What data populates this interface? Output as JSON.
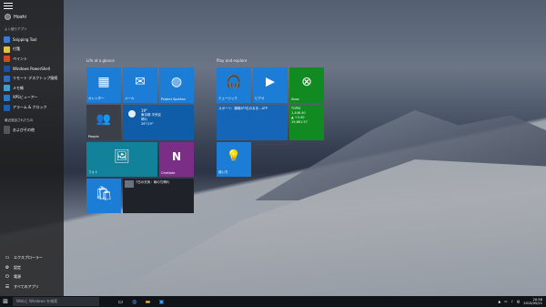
{
  "user": {
    "name": "Hoshi"
  },
  "start": {
    "most_used_label": "よく使うアプリ",
    "apps": [
      {
        "label": "Snipping Tool",
        "color": "#3a7bd5"
      },
      {
        "label": "付箋",
        "color": "#e1c542"
      },
      {
        "label": "ペイント",
        "color": "#d04a2a"
      },
      {
        "label": "Windows PowerShell",
        "color": "#1d4f9a"
      },
      {
        "label": "リモート デスクトップ接続",
        "color": "#2b6cc4"
      },
      {
        "label": "メモ帳",
        "color": "#3aa0d8"
      },
      {
        "label": "XPSビューアー",
        "color": "#2a7ac8"
      },
      {
        "label": "アラーム & クロック",
        "color": "#1b5fb0"
      }
    ],
    "recent_label": "最近追加されたもの",
    "recent_app": "およびその他",
    "bottom": [
      {
        "label": "エクスプローラー",
        "glyph": "▭"
      },
      {
        "label": "設定",
        "glyph": "⚙"
      },
      {
        "label": "電源",
        "glyph": "⏻"
      },
      {
        "label": "すべてのアプリ",
        "glyph": "☰"
      }
    ]
  },
  "groups": {
    "left": "Life at a glance",
    "right": "Play and explore"
  },
  "tiles": {
    "calendar": "カレンダー",
    "mail": "メール",
    "project_spartan": "Project Spartan",
    "people": "People",
    "weather": {
      "temp": "19°",
      "city": "東京都 中央区",
      "cond": "晴れ",
      "range": "26°/19°"
    },
    "photos": "フォト",
    "onenote": "OneNote",
    "store": "",
    "news_headline": "7日の天気：雨のち晴れ",
    "groove": "ミュージック",
    "video": "ビデオ",
    "xbox": "Xbox",
    "sports": {
      "text": "スポーツ：錦織が7位のまま…ATP"
    },
    "finance": {
      "name": "TOPIX",
      "v1": "1,446.40",
      "v2": "▲ +3.40",
      "v3": "19,861.57"
    },
    "tips": "使い方"
  },
  "taskbar": {
    "search_placeholder": "Webと Windows を検索",
    "time": "20:58",
    "date": "2015/05/21"
  }
}
